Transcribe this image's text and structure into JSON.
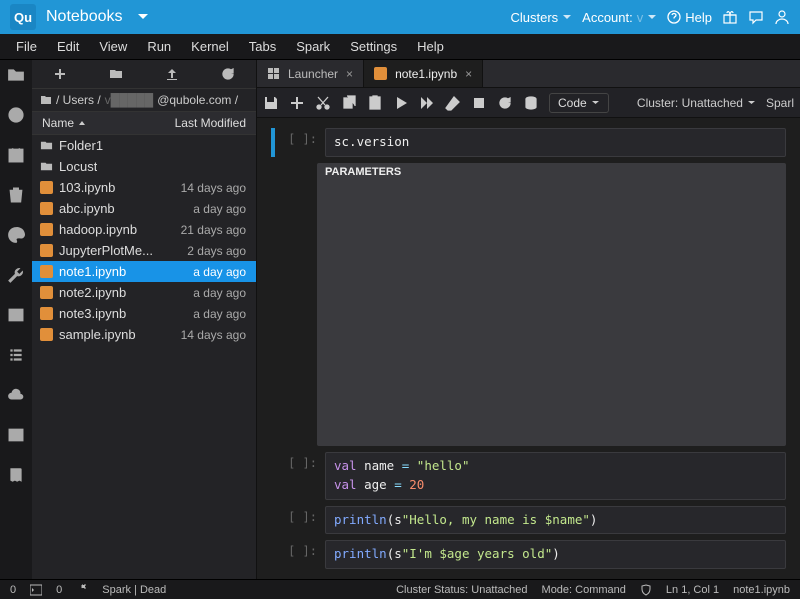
{
  "topbar": {
    "logo": "Qu",
    "title": "Notebooks",
    "clusters": "Clusters",
    "account": "Account:",
    "help": "Help"
  },
  "menubar": [
    "File",
    "Edit",
    "View",
    "Run",
    "Kernel",
    "Tabs",
    "Spark",
    "Settings",
    "Help"
  ],
  "breadcrumb": {
    "root": "/ Users /",
    "domain": "@qubole.com /"
  },
  "fileheader": {
    "name": "Name",
    "modified": "Last Modified"
  },
  "files": [
    {
      "type": "folder",
      "name": "Folder1",
      "time": ""
    },
    {
      "type": "folder",
      "name": "Locust",
      "time": ""
    },
    {
      "type": "nb",
      "name": "103.ipynb",
      "time": "14 days ago"
    },
    {
      "type": "nb",
      "name": "abc.ipynb",
      "time": "a day ago"
    },
    {
      "type": "nb",
      "name": "hadoop.ipynb",
      "time": "21 days ago"
    },
    {
      "type": "nb",
      "name": "JupyterPlotMe...",
      "time": "2 days ago"
    },
    {
      "type": "nb",
      "name": "note1.ipynb",
      "time": "a day ago",
      "sel": true
    },
    {
      "type": "nb",
      "name": "note2.ipynb",
      "time": "a day ago"
    },
    {
      "type": "nb",
      "name": "note3.ipynb",
      "time": "a day ago"
    },
    {
      "type": "nb",
      "name": "sample.ipynb",
      "time": "14 days ago"
    }
  ],
  "tabs": [
    {
      "label": "Launcher",
      "icon": "launcher"
    },
    {
      "label": "note1.ipynb",
      "icon": "nb",
      "active": true
    }
  ],
  "toolbar": {
    "cellType": "Code",
    "cluster": "Cluster: Unattached",
    "kernel": "Sparl"
  },
  "cells": [
    {
      "prompt": "[ ]:",
      "code": [
        {
          "t": "sc.version",
          "c": "id"
        }
      ],
      "active": true
    },
    {
      "params": "PARAMETERS"
    },
    {
      "prompt": "[ ]:",
      "lines": [
        [
          {
            "t": "val",
            "c": "kw"
          },
          {
            "t": " name ",
            "c": "id"
          },
          {
            "t": "=",
            "c": "op"
          },
          {
            "t": " ",
            "c": "id"
          },
          {
            "t": "\"hello\"",
            "c": "st"
          }
        ],
        [
          {
            "t": "val",
            "c": "kw"
          },
          {
            "t": " age ",
            "c": "id"
          },
          {
            "t": "=",
            "c": "op"
          },
          {
            "t": " ",
            "c": "id"
          },
          {
            "t": "20",
            "c": "nm2"
          }
        ]
      ]
    },
    {
      "prompt": "[ ]:",
      "lines": [
        [
          {
            "t": "println",
            "c": "fn"
          },
          {
            "t": "(s",
            "c": "id"
          },
          {
            "t": "\"Hello, my name is $name\"",
            "c": "st"
          },
          {
            "t": ")",
            "c": "id"
          }
        ]
      ]
    },
    {
      "prompt": "[ ]:",
      "lines": [
        [
          {
            "t": "println",
            "c": "fn"
          },
          {
            "t": "(s",
            "c": "id"
          },
          {
            "t": "\"I'm $age years old\"",
            "c": "st"
          },
          {
            "t": ")",
            "c": "id"
          }
        ]
      ]
    }
  ],
  "status": {
    "left1": "0",
    "left2": "0",
    "kernel": "Spark | Dead",
    "cluster": "Cluster Status: Unattached",
    "mode": "Mode: Command",
    "pos": "Ln 1, Col 1",
    "file": "note1.ipynb"
  }
}
